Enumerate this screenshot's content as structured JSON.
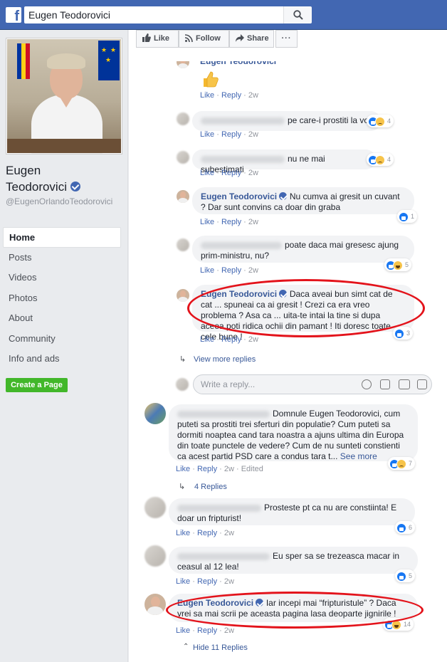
{
  "topbar": {
    "logo": "f",
    "search_value": "Eugen Teodorovici"
  },
  "sidebar": {
    "name_line1": "Eugen",
    "name_line2": "Teodorovici",
    "handle": "@EugenOrlandoTeodorovici",
    "nav": [
      "Home",
      "Posts",
      "Videos",
      "Photos",
      "About",
      "Community",
      "Info and ads"
    ],
    "create_page": "Create a Page"
  },
  "actions": {
    "like": "Like",
    "follow": "Follow",
    "share": "Share",
    "more": "···"
  },
  "labels": {
    "like": "Like",
    "reply": "Reply",
    "see_more": "See more",
    "edited": "Edited"
  },
  "replies": [
    {
      "author": "Eugen Teodorovici",
      "text": "",
      "time": "2w"
    },
    {
      "text": "pe care-i prostiti la vot",
      "time": "2w",
      "reactions": "4"
    },
    {
      "text": "nu ne mai subestimati",
      "time": "2w",
      "reactions": "4"
    },
    {
      "author": "Eugen Teodorovici",
      "text": "Nu cumva ai gresit un cuvant ? Dar sunt convins ca doar din graba",
      "time": "2w",
      "reactions": "1"
    },
    {
      "text": "poate daca mai gresesc ajung prim-ministru, nu?",
      "time": "2w",
      "reactions": "5"
    },
    {
      "author": "Eugen Teodorovici",
      "text": "Daca aveai bun simt cat de cat ... spuneai ca ai gresit ! Crezi ca era vreo problema ? Asa ca ... uita-te intai la tine si dupa aceea poti ridica ochii din pamant ! Iti doresc toate cele bune !",
      "time": "2w",
      "reactions": "3"
    }
  ],
  "view_more_replies": "View more replies",
  "reply_placeholder": "Write a reply...",
  "comments": [
    {
      "text": "Domnule Eugen Teodorovici, cum puteti sa prostiti trei sferturi din populatie? Cum puteti sa dormiti noaptea cand tara noastra a ajuns ultima din Europa din toate punctele de vedere? Cum de nu sunteti constienti ca acest partid PSD care a condus tara t...",
      "time": "2w",
      "reactions": "7",
      "replies_link": "4 Replies"
    },
    {
      "text": "Prosteste pt ca nu are constiinta! E doar un fripturist!",
      "time": "2w",
      "reactions": "6"
    },
    {
      "text": "Eu sper sa se trezeasca macar in ceasul al 12 lea!",
      "time": "2w",
      "reactions": "5"
    },
    {
      "author": "Eugen Teodorovici",
      "text": "Iar incepi mai “fripturistule” ? Daca vrei sa mai scrii pe aceasta pagina lasa deoparte jignirile !",
      "time": "2w",
      "reactions": "14"
    }
  ],
  "hide_replies": "Hide 11 Replies",
  "colors": {
    "brand": "#4267b2",
    "link": "#385898",
    "highlight": "#e3131b",
    "create_page": "#42b72a"
  }
}
